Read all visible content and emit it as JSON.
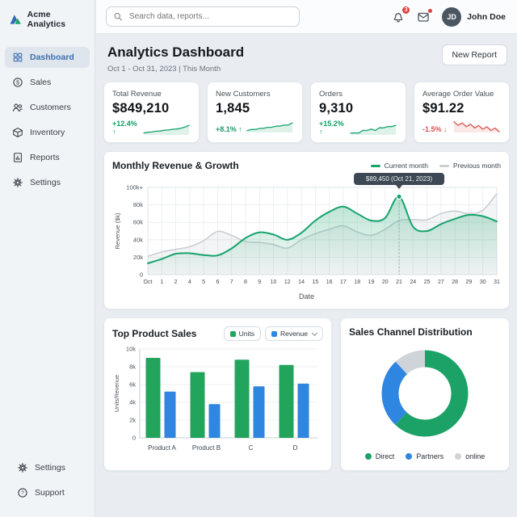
{
  "app": {
    "name": "Acme Analytics"
  },
  "header": {
    "search_placeholder": "Search data, reports...",
    "notifications_count": "3",
    "user": {
      "initials": "JD",
      "name": "John Doe"
    }
  },
  "sidebar": {
    "items": [
      {
        "label": "Dashboard",
        "icon": "dashboard",
        "active": true
      },
      {
        "label": "Sales",
        "icon": "sales",
        "active": false
      },
      {
        "label": "Customers",
        "icon": "customers",
        "active": false
      },
      {
        "label": "Inventory",
        "icon": "inventory",
        "active": false
      },
      {
        "label": "Reports",
        "icon": "reports",
        "active": false
      },
      {
        "label": "Settings",
        "icon": "settings",
        "active": false
      }
    ],
    "footer_items": [
      {
        "label": "Settings",
        "icon": "settings"
      },
      {
        "label": "Support",
        "icon": "support"
      }
    ]
  },
  "page": {
    "title": "Analytics Dashboard",
    "date_range": "Oct 1 - Oct 31, 2023 | This Month",
    "new_report_label": "New Report"
  },
  "stats": [
    {
      "label": "Total Revenue",
      "value": "$849,210",
      "change": "+12.4% ↑",
      "direction": "up",
      "spark": [
        4,
        6,
        5,
        7,
        6,
        8,
        7,
        9,
        8,
        10,
        10,
        13
      ]
    },
    {
      "label": "New Customers",
      "value": "1,845",
      "change": "+8.1% ↑",
      "direction": "up",
      "spark": [
        4,
        6,
        5,
        7,
        6,
        8,
        7,
        9,
        8,
        10,
        9,
        12
      ]
    },
    {
      "label": "Orders",
      "value": "9,310",
      "change": "+15.2% ↑",
      "direction": "up",
      "spark": [
        5,
        6,
        5,
        8,
        7,
        9,
        7,
        10,
        9,
        11,
        10,
        12
      ]
    },
    {
      "label": "Average Order Value",
      "value": "$91.22",
      "change": "-1.5% ↓",
      "direction": "down",
      "spark": [
        12,
        10,
        11,
        9,
        10,
        8,
        9,
        7,
        8,
        6,
        7,
        5
      ]
    }
  ],
  "colors": {
    "green": "#18a36d",
    "bar_green": "#22a45c",
    "blue": "#2e86e0",
    "red": "#d9534f",
    "gray_series": "#c9ced3",
    "grid": "#e7ebee",
    "tooltip_bg": "#3d4854",
    "accent_nav": "#3f6fae"
  },
  "chart_data": [
    {
      "id": "revenue_growth",
      "type": "line",
      "title": "Monthly Revenue & Growth",
      "xlabel": "Date",
      "ylabel": "Revenue ($k)",
      "x": [
        "Oct",
        "1",
        "2",
        "4",
        "5",
        "6",
        "7",
        "8",
        "9",
        "10",
        "12",
        "14",
        "15",
        "16",
        "17",
        "18",
        "19",
        "20",
        "21",
        "24",
        "25",
        "27",
        "28",
        "29",
        "30",
        "31"
      ],
      "yticks": [
        "0",
        "20k",
        "40k",
        "60k",
        "80k",
        "100k+"
      ],
      "ylim": [
        0,
        100
      ],
      "grid": true,
      "legend_position": "top-right",
      "series": [
        {
          "name": "Current month",
          "color": "#18a36d",
          "values": [
            13,
            18,
            24,
            24.5,
            22.5,
            22,
            30,
            42,
            48.5,
            46,
            40,
            48,
            62,
            72,
            78,
            70,
            62,
            65,
            89.45,
            55,
            50,
            58,
            64,
            68.5,
            67,
            61
          ]
        },
        {
          "name": "Previous month",
          "color": "#c9ced3",
          "values": [
            21,
            26,
            29,
            32,
            39,
            49.5,
            45,
            38,
            37,
            34.5,
            30.5,
            40,
            47,
            52,
            56,
            49,
            45,
            52,
            62,
            63,
            63,
            70,
            73,
            70,
            74,
            93
          ]
        }
      ],
      "annotation": {
        "text": "$89,450 (Oct 21, 2023)",
        "x_index": 18,
        "value": 89.45
      }
    },
    {
      "id": "top_products",
      "type": "bar",
      "title": "Top Product Sales",
      "categories": [
        "Product A",
        "Product B",
        "C",
        "D"
      ],
      "series": [
        {
          "name": "Units",
          "color": "#22a45c",
          "values": [
            9000,
            7400,
            8800,
            8200
          ]
        },
        {
          "name": "Revenue",
          "color": "#2e86e0",
          "values": [
            5200,
            3800,
            5800,
            6100
          ],
          "has_dropdown": true
        }
      ],
      "ylabel": "Units/Revenue",
      "yticks": [
        "0",
        "2k",
        "4k",
        "6k",
        "8k",
        "10k"
      ],
      "ylim": [
        0,
        10000
      ],
      "grid": true
    },
    {
      "id": "sales_channels",
      "type": "pie",
      "title": "Sales Channel Distribution",
      "donut": true,
      "legend_position": "bottom",
      "slices": [
        {
          "label": "Direct",
          "color": "#1ca266",
          "value": 62
        },
        {
          "label": "Partners",
          "color": "#2e86e0",
          "value": 26
        },
        {
          "label": "online",
          "color": "#cfd4d9",
          "value": 12
        }
      ]
    }
  ]
}
